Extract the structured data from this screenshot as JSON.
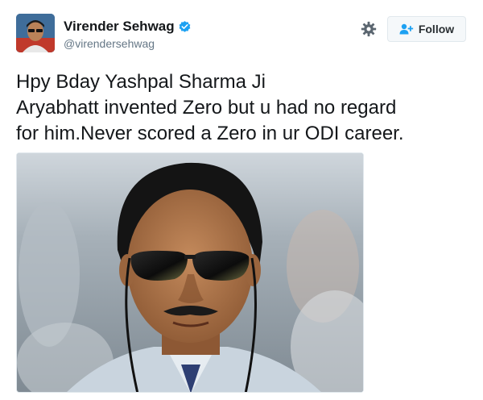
{
  "author": {
    "name": "Virender Sehwag",
    "handle": "@virendersehwag",
    "verified": true
  },
  "actions": {
    "settings_icon": "gear-icon",
    "follow_label": "Follow",
    "follow_icon": "add-user-icon"
  },
  "tweet": {
    "lines": [
      "Hpy Bday Yashpal Sharma Ji",
      "Aryabhatt invented Zero but u had no regard",
      "for him.Never scored a Zero in ur ODI career."
    ]
  },
  "colors": {
    "verified_blue": "#1da1f2",
    "follow_icon_blue": "#1da1f2",
    "text": "#14171a",
    "secondary_text": "#657786"
  }
}
